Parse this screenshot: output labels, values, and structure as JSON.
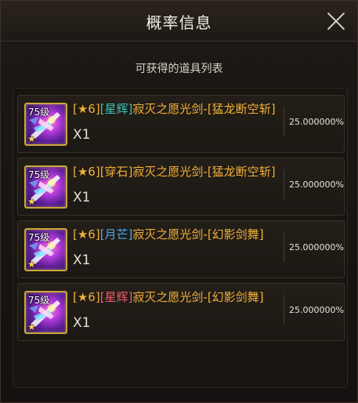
{
  "dialog": {
    "title": "概率信息",
    "subtitle": "可获得的道具列表"
  },
  "items": [
    {
      "level": "75级",
      "star_tag": "[★6]",
      "prefix": "[星辉]",
      "prefix_color": "#35c7b6",
      "name": "寂灭之愿光剑-[猛龙断空斩]",
      "quantity": "X1",
      "rate": "25.000000%"
    },
    {
      "level": "75级",
      "star_tag": "[★6]",
      "prefix": "[穿石]",
      "prefix_color": "#f0b03a",
      "name": "寂灭之愿光剑-[猛龙断空斩]",
      "quantity": "X1",
      "rate": "25.000000%"
    },
    {
      "level": "75级",
      "star_tag": "[★6]",
      "prefix": "[月芒]",
      "prefix_color": "#4aa7f0",
      "name": "寂灭之愿光剑-[幻影剑舞]",
      "quantity": "X1",
      "rate": "25.000000%"
    },
    {
      "level": "75级",
      "star_tag": "[★6]",
      "prefix": "[星辉]",
      "prefix_color": "#f05a6a",
      "name": "寂灭之愿光剑-[幻影剑舞]",
      "quantity": "X1",
      "rate": "25.000000%"
    }
  ],
  "colors": {
    "name_gold": "#f0b03a",
    "icon_border": "#c9a83a"
  },
  "icons": {
    "close": "close-icon",
    "item": "sword-item-icon",
    "star": "star-icon"
  }
}
